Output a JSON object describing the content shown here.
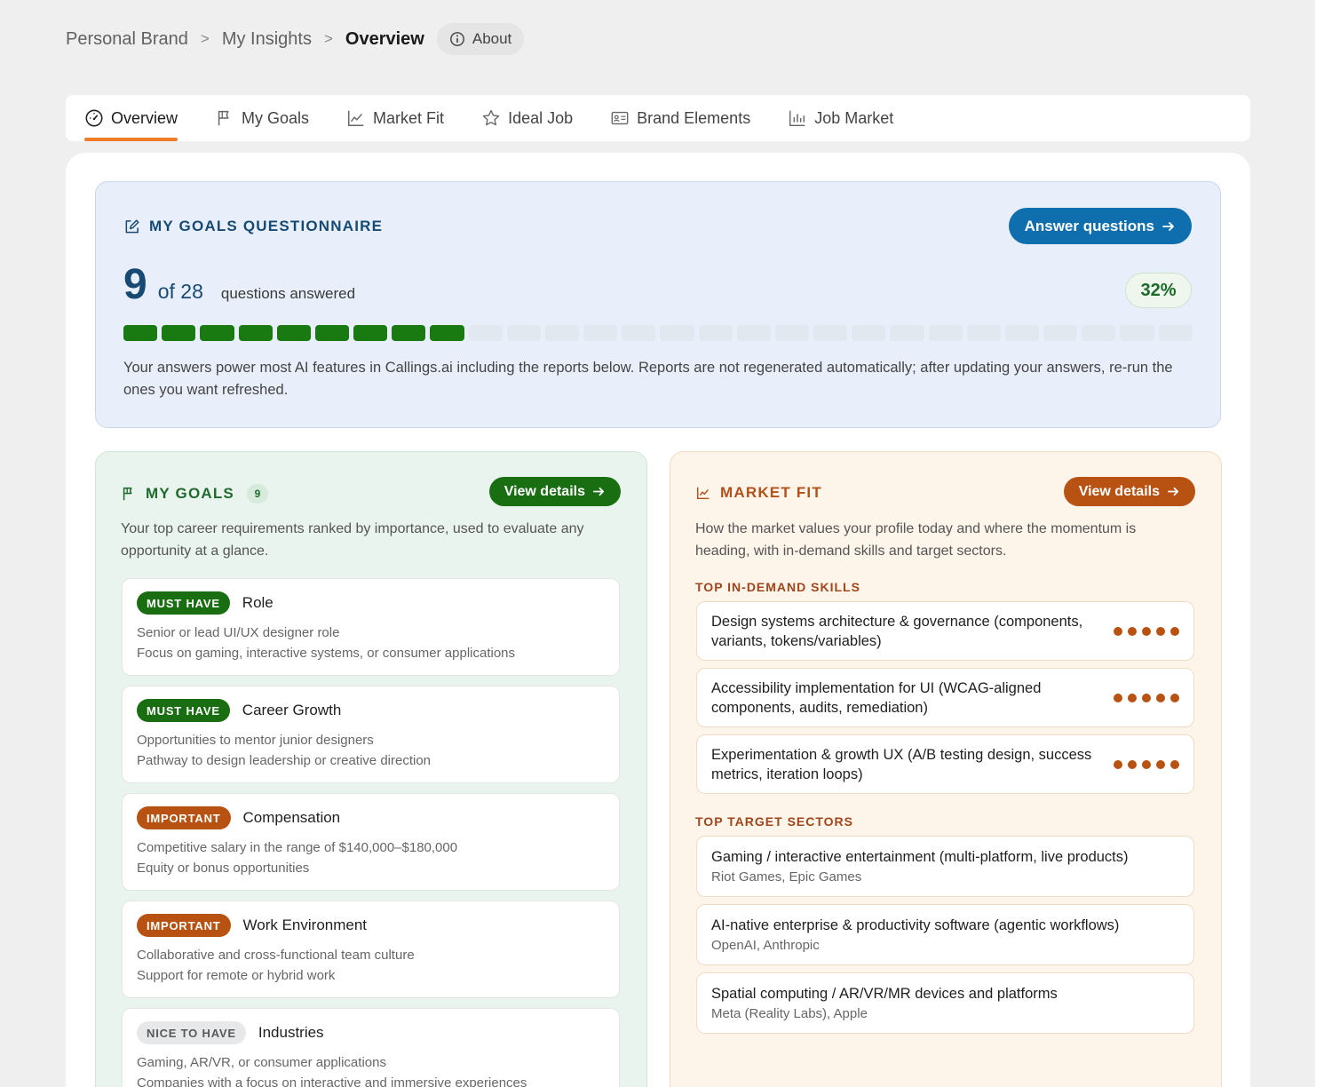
{
  "breadcrumb": {
    "items": [
      "Personal Brand",
      "My Insights"
    ],
    "current": "Overview",
    "about_label": "About"
  },
  "tabs": [
    {
      "label": "Overview",
      "icon": "gauge-icon",
      "active": true
    },
    {
      "label": "My Goals",
      "icon": "flag-icon"
    },
    {
      "label": "Market Fit",
      "icon": "line-chart-icon"
    },
    {
      "label": "Ideal Job",
      "icon": "star-icon"
    },
    {
      "label": "Brand Elements",
      "icon": "id-card-icon"
    },
    {
      "label": "Job Market",
      "icon": "bar-chart-icon"
    }
  ],
  "questionnaire": {
    "title": "MY GOALS QUESTIONNAIRE",
    "button_label": "Answer questions",
    "answered": "9",
    "of_total": "of 28",
    "answered_label": "questions answered",
    "percent": "32%",
    "answered_count": 9,
    "total_count": 28,
    "description": "Your answers power most AI features in Callings.ai including the reports below. Reports are not regenerated automatically; after updating your answers, re-run the ones you want refreshed."
  },
  "goals": {
    "title": "MY GOALS",
    "count": "9",
    "button_label": "View details",
    "description": "Your top career requirements ranked by importance, used to evaluate any opportunity at a glance.",
    "items": [
      {
        "tag": "MUST HAVE",
        "name": "Role",
        "line1": "Senior or lead UI/UX designer role",
        "line2": "Focus on gaming, interactive systems, or consumer applications"
      },
      {
        "tag": "MUST HAVE",
        "name": "Career Growth",
        "line1": "Opportunities to mentor junior designers",
        "line2": "Pathway to design leadership or creative direction"
      },
      {
        "tag": "IMPORTANT",
        "name": "Compensation",
        "line1": "Competitive salary in the range of $140,000–$180,000",
        "line2": "Equity or bonus opportunities"
      },
      {
        "tag": "IMPORTANT",
        "name": "Work Environment",
        "line1": "Collaborative and cross-functional team culture",
        "line2": "Support for remote or hybrid work"
      },
      {
        "tag": "NICE TO HAVE",
        "name": "Industries",
        "line1": "Gaming, AR/VR, or consumer applications",
        "line2": "Companies with a focus on interactive and immersive experiences"
      }
    ]
  },
  "market": {
    "title": "MARKET FIT",
    "button_label": "View details",
    "description": "How the market values your profile today and where the momentum is heading, with in-demand skills and target sectors.",
    "skills_heading": "TOP IN-DEMAND SKILLS",
    "skills": [
      {
        "label": "Design systems architecture & governance (components, variants, tokens/variables)",
        "rating": 5
      },
      {
        "label": "Accessibility implementation for UI (WCAG-aligned components, audits, remediation)",
        "rating": 5
      },
      {
        "label": "Experimentation & growth UX (A/B testing design, success metrics, iteration loops)",
        "rating": 5
      }
    ],
    "sectors_heading": "TOP TARGET SECTORS",
    "sectors": [
      {
        "name": "Gaming / interactive entertainment (multi-platform, live products)",
        "companies": "Riot Games, Epic Games"
      },
      {
        "name": "AI-native enterprise & productivity software (agentic workflows)",
        "companies": "OpenAI, Anthropic"
      },
      {
        "name": "Spatial computing / AR/VR/MR devices and platforms",
        "companies": "Meta (Reality Labs), Apple"
      }
    ]
  },
  "colors": {
    "accent_orange": "#f07c28",
    "primary_blue": "#0f6fae",
    "goal_green": "#1a6e12",
    "market_orange": "#b85212"
  }
}
